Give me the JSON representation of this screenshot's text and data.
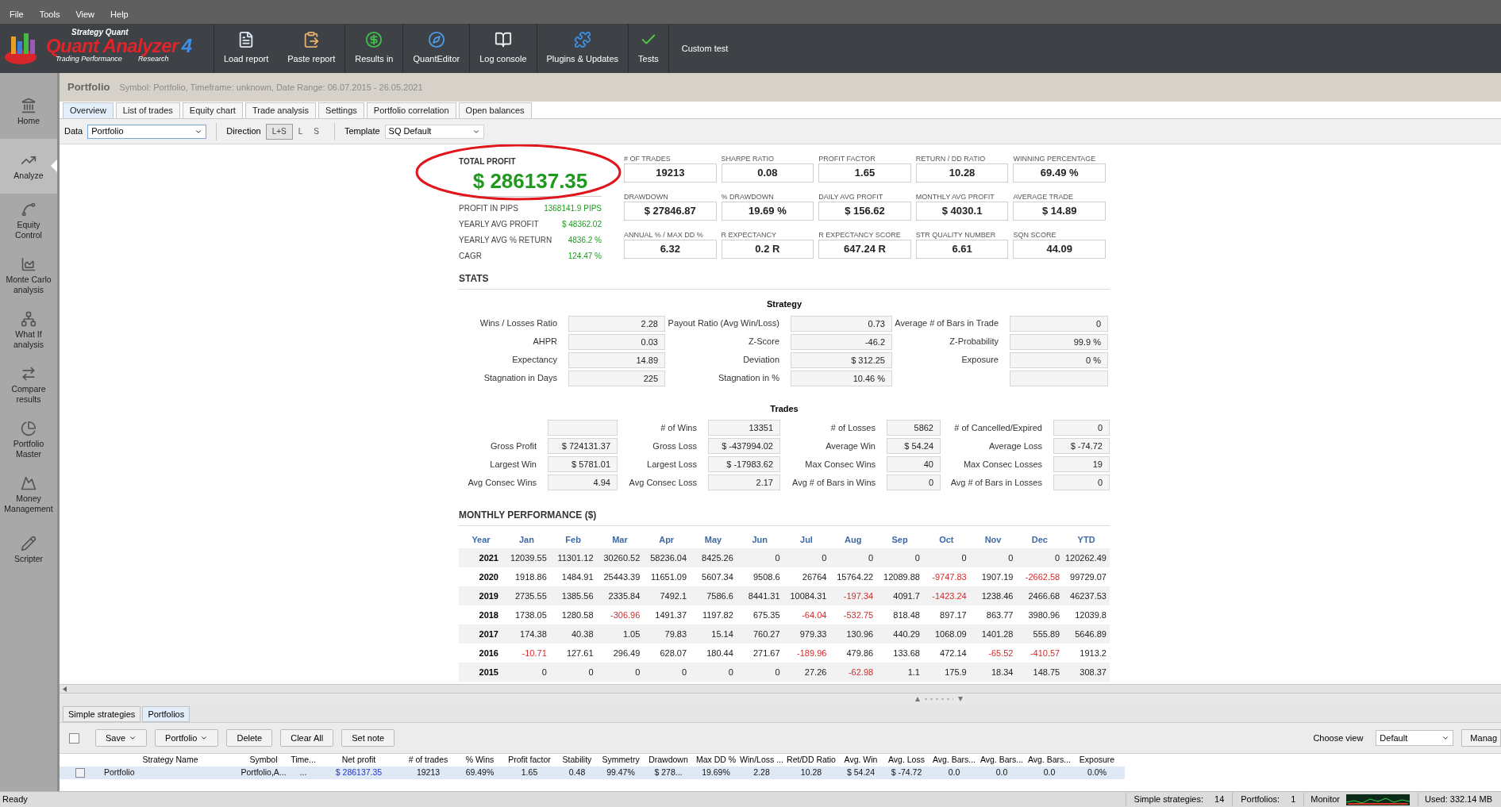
{
  "menu": [
    "File",
    "Tools",
    "View",
    "Help"
  ],
  "logo": {
    "brand": "Strategy Quant",
    "name": "Quant Analyzer",
    "version": "4",
    "tagline": "Trading Performance",
    "tagline2": "Research"
  },
  "toolbar": [
    {
      "label": "Load report"
    },
    {
      "label": "Paste report"
    },
    {
      "label": "Results in"
    },
    {
      "label": "QuantEditor"
    },
    {
      "label": "Log console"
    },
    {
      "label": "Plugins & Updates"
    },
    {
      "label": "Tests"
    }
  ],
  "toolbar_link": "Custom test",
  "sidebar": [
    {
      "label": "Home",
      "selected": false
    },
    {
      "label": "Analyze",
      "selected": true
    },
    {
      "label": "Equity Control",
      "selected": false
    },
    {
      "label": "Monte Carlo analysis",
      "selected": false
    },
    {
      "label": "What If analysis",
      "selected": false
    },
    {
      "label": "Compare results",
      "selected": false
    },
    {
      "label": "Portfolio Master",
      "selected": false
    },
    {
      "label": "Money Management",
      "selected": false
    },
    {
      "label": "Scripter",
      "selected": false
    }
  ],
  "header": {
    "title": "Portfolio",
    "subtitle": "Symbol: Portfolio, Timeframe: unknown, Date Range: 06.07.2015 - 26.05.2021"
  },
  "tabs": [
    {
      "label": "Overview",
      "selected": true
    },
    {
      "label": "List of trades",
      "selected": false
    },
    {
      "label": "Equity chart",
      "selected": false
    },
    {
      "label": "Trade analysis",
      "selected": false
    },
    {
      "label": "Settings",
      "selected": false
    },
    {
      "label": "Portfolio correlation",
      "selected": false
    },
    {
      "label": "Open balances",
      "selected": false
    }
  ],
  "filters": {
    "data_label": "Data",
    "data_value": "Portfolio",
    "direction_label": "Direction",
    "direction_options": [
      {
        "label": "L+S",
        "selected": true
      },
      {
        "label": "L",
        "selected": false
      },
      {
        "label": "S",
        "selected": false
      }
    ],
    "template_label": "Template",
    "template_value": "SQ Default"
  },
  "total_profit": {
    "label": "TOTAL PROFIT",
    "value": "$ 286137.35",
    "rows": [
      {
        "label": "PROFIT IN PIPS",
        "value": "1368141.9 PIPS"
      },
      {
        "label": "YEARLY AVG PROFIT",
        "value": "$ 48362.02"
      },
      {
        "label": "YEARLY AVG % RETURN",
        "value": "4836.2 %"
      },
      {
        "label": "CAGR",
        "value": "124.47 %"
      }
    ]
  },
  "metrics": [
    {
      "label": "# OF TRADES",
      "value": "19213"
    },
    {
      "label": "SHARPE RATIO",
      "value": "0.08"
    },
    {
      "label": "PROFIT FACTOR",
      "value": "1.65"
    },
    {
      "label": "RETURN / DD RATIO",
      "value": "10.28"
    },
    {
      "label": "WINNING PERCENTAGE",
      "value": "69.49 %"
    },
    {
      "label": "DRAWDOWN",
      "value": "$ 27846.87"
    },
    {
      "label": "% DRAWDOWN",
      "value": "19.69 %"
    },
    {
      "label": "DAILY AVG PROFIT",
      "value": "$ 156.62"
    },
    {
      "label": "MONTHLY AVG PROFIT",
      "value": "$ 4030.1"
    },
    {
      "label": "AVERAGE TRADE",
      "value": "$ 14.89"
    },
    {
      "label": "ANNUAL % / MAX DD %",
      "value": "6.32"
    },
    {
      "label": "R EXPECTANCY",
      "value": "0.2 R"
    },
    {
      "label": "R EXPECTANCY SCORE",
      "value": "647.24 R"
    },
    {
      "label": "STR QUALITY NUMBER",
      "value": "6.61"
    },
    {
      "label": "SQN SCORE",
      "value": "44.09"
    }
  ],
  "stats": {
    "title": "STATS",
    "strategy": {
      "title": "Strategy",
      "rows": [
        [
          {
            "label": "Wins / Losses Ratio",
            "value": "2.28"
          },
          {
            "label": "Payout Ratio (Avg Win/Loss)",
            "value": "0.73"
          },
          {
            "label": "Average # of Bars in Trade",
            "value": "0"
          }
        ],
        [
          {
            "label": "AHPR",
            "value": "0.03"
          },
          {
            "label": "Z-Score",
            "value": "-46.2"
          },
          {
            "label": "Z-Probability",
            "value": "99.9 %"
          }
        ],
        [
          {
            "label": "Expectancy",
            "value": "14.89"
          },
          {
            "label": "Deviation",
            "value": "$ 312.25"
          },
          {
            "label": "Exposure",
            "value": "0 %"
          }
        ],
        [
          {
            "label": "Stagnation in Days",
            "value": "225"
          },
          {
            "label": "Stagnation in %",
            "value": "10.46 %"
          },
          {}
        ]
      ]
    },
    "trades": {
      "title": "Trades",
      "rows": [
        [
          {},
          {
            "label": "# of Wins",
            "value": "13351"
          },
          {
            "label": "# of Losses",
            "value": "5862"
          },
          {
            "label": "# of Cancelled/Expired",
            "value": "0"
          }
        ],
        [
          {
            "label": "Gross Profit",
            "value": "$ 724131.37"
          },
          {
            "label": "Gross Loss",
            "value": "$ -437994.02"
          },
          {
            "label": "Average Win",
            "value": "$ 54.24"
          },
          {
            "label": "Average Loss",
            "value": "$ -74.72"
          }
        ],
        [
          {
            "label": "Largest Win",
            "value": "$ 5781.01"
          },
          {
            "label": "Largest Loss",
            "value": "$ -17983.62"
          },
          {
            "label": "Max Consec Wins",
            "value": "40"
          },
          {
            "label": "Max Consec Losses",
            "value": "19"
          }
        ],
        [
          {
            "label": "Avg Consec Wins",
            "value": "4.94"
          },
          {
            "label": "Avg Consec Loss",
            "value": "2.17"
          },
          {
            "label": "Avg # of Bars in Wins",
            "value": "0"
          },
          {
            "label": "Avg # of Bars in Losses",
            "value": "0"
          }
        ]
      ]
    }
  },
  "monthly": {
    "title": "MONTHLY PERFORMANCE ($)",
    "columns": [
      "Year",
      "Jan",
      "Feb",
      "Mar",
      "Apr",
      "May",
      "Jun",
      "Jul",
      "Aug",
      "Sep",
      "Oct",
      "Nov",
      "Dec",
      "YTD"
    ],
    "rows": [
      {
        "year": "2021",
        "values": [
          "12039.55",
          "11301.12",
          "30260.52",
          "58236.04",
          "8425.26",
          "0",
          "0",
          "0",
          "0",
          "0",
          "0",
          "0",
          "120262.49"
        ]
      },
      {
        "year": "2020",
        "values": [
          "1918.86",
          "1484.91",
          "25443.39",
          "11651.09",
          "5607.34",
          "9508.6",
          "26764",
          "15764.22",
          "12089.88",
          "-9747.83",
          "1907.19",
          "-2662.58",
          "99729.07"
        ]
      },
      {
        "year": "2019",
        "values": [
          "2735.55",
          "1385.56",
          "2335.84",
          "7492.1",
          "7586.6",
          "8441.31",
          "10084.31",
          "-197.34",
          "4091.7",
          "-1423.24",
          "1238.46",
          "2466.68",
          "46237.53"
        ]
      },
      {
        "year": "2018",
        "values": [
          "1738.05",
          "1280.58",
          "-306.96",
          "1491.37",
          "1197.82",
          "675.35",
          "-64.04",
          "-532.75",
          "818.48",
          "897.17",
          "863.77",
          "3980.96",
          "12039.8"
        ]
      },
      {
        "year": "2017",
        "values": [
          "174.38",
          "40.38",
          "1.05",
          "79.83",
          "15.14",
          "760.27",
          "979.33",
          "130.96",
          "440.29",
          "1068.09",
          "1401.28",
          "555.89",
          "5646.89"
        ]
      },
      {
        "year": "2016",
        "values": [
          "-10.71",
          "127.61",
          "296.49",
          "628.07",
          "180.44",
          "271.67",
          "-189.96",
          "479.86",
          "133.68",
          "472.14",
          "-65.52",
          "-410.57",
          "1913.2"
        ]
      },
      {
        "year": "2015",
        "values": [
          "0",
          "0",
          "0",
          "0",
          "0",
          "0",
          "27.26",
          "-62.98",
          "1.1",
          "175.9",
          "18.34",
          "148.75",
          "308.37"
        ]
      }
    ]
  },
  "bottom": {
    "tabs": [
      {
        "label": "Simple strategies",
        "selected": false
      },
      {
        "label": "Portfolios",
        "selected": true
      }
    ],
    "select_all": {
      "checked": false
    },
    "buttons": [
      {
        "label": "Save",
        "dropdown": true
      },
      {
        "label": "Portfolio",
        "dropdown": true
      },
      {
        "label": "Delete",
        "dropdown": false
      },
      {
        "label": "Clear All",
        "dropdown": false
      },
      {
        "label": "Set note",
        "dropdown": false
      }
    ],
    "view_label": "Choose view",
    "view_value": "Default",
    "manage_button": "Manag",
    "columns": [
      "Strategy Name",
      "Symbol",
      "Time...",
      "Net profit",
      "# of trades",
      "% Wins",
      "Profit factor",
      "Stability",
      "Symmetry",
      "Drawdown",
      "Max DD %",
      "Win/Loss ...",
      "Ret/DD Ratio",
      "Avg. Win",
      "Avg. Loss",
      "Avg. Bars...",
      "Avg. Bars...",
      "Avg. Bars...",
      "Exposure"
    ],
    "rows": [
      {
        "selected": true,
        "checked": false,
        "cells": [
          "Portfolio",
          "Portfolio,A...",
          "...",
          "$ 286137.35",
          "19213",
          "69.49%",
          "1.65",
          "0.48",
          "99.47%",
          "$ 278...",
          "19.69%",
          "2.28",
          "10.28",
          "$ 54.24",
          "$ -74.72",
          "0.0",
          "0.0",
          "0.0",
          "0.0%"
        ]
      }
    ]
  },
  "status_bar": {
    "ready": "Ready",
    "items": [
      {
        "label": "Simple strategies:",
        "value": "14"
      },
      {
        "label": "Portfolios:",
        "value": "1"
      }
    ],
    "monitor": "Monitor",
    "memory": "Used: 332.14 MB"
  }
}
